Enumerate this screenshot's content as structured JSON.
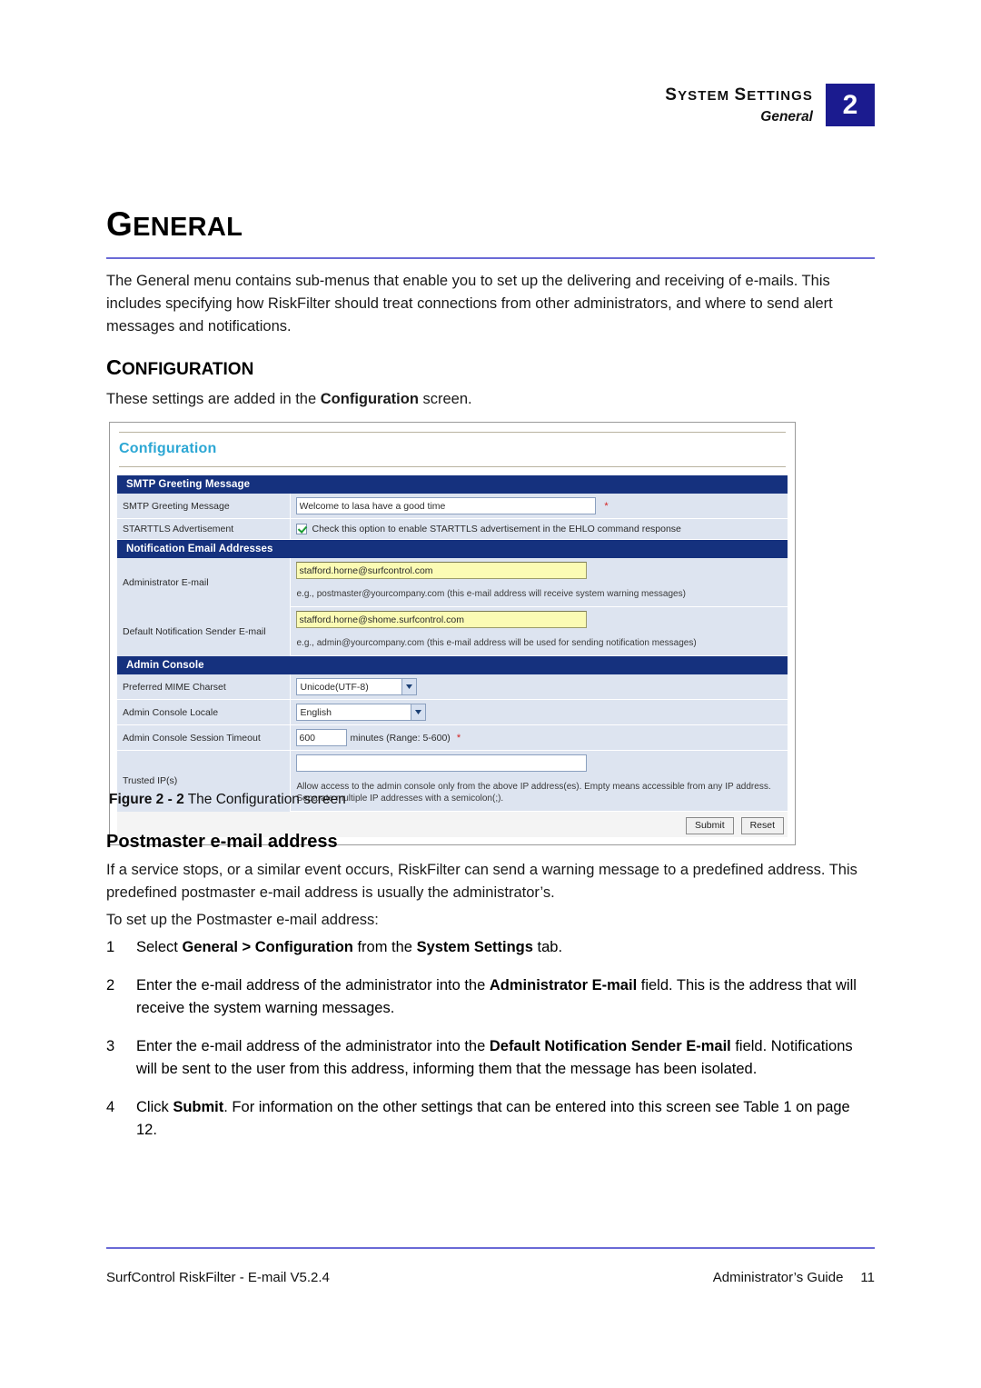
{
  "running_header": {
    "title": "SYSTEM SETTINGS",
    "subtitle": "General",
    "chapter_number": "2",
    "chapter_box_color": "#1b1b8f"
  },
  "chapter": {
    "heading": "GENERAL",
    "rule_color": "#6a6ad6",
    "intro": "The General menu contains sub-menus that enable you to set up the delivering and receiving of e-mails. This includes specifying how RiskFilter should treat connections from other administrators, and where to send alert messages and notifications."
  },
  "configuration_section": {
    "heading": "CONFIGURATION",
    "intro_before": "These settings are added in the ",
    "intro_bold": "Configuration",
    "intro_after": " screen."
  },
  "figure": {
    "title": "Configuration",
    "title_color": "#2ca7d4",
    "section_header_color": "#15317e",
    "row_background": "#dde4f0",
    "highlight_field_color": "#fbfbb4",
    "sections": [
      {
        "header": "SMTP Greeting Message",
        "rows": [
          {
            "label": "SMTP Greeting Message",
            "type": "text",
            "value": "Welcome to lasa have a good time",
            "required_marker": "*"
          },
          {
            "label": "STARTTLS Advertisement",
            "type": "checkbox",
            "checked": true,
            "checkbox_label": "Check this option to enable STARTTLS advertisement in the EHLO command response"
          }
        ]
      },
      {
        "header": "Notification Email Addresses",
        "rows": [
          {
            "label": "Administrator E-mail",
            "type": "text-highlight",
            "value": "stafford.horne@surfcontrol.com",
            "hint": "e.g., postmaster@yourcompany.com (this e-mail address will receive system warning messages)"
          },
          {
            "label": "Default Notification Sender E-mail",
            "type": "text-highlight",
            "value": "stafford.horne@shome.surfcontrol.com",
            "hint": "e.g., admin@yourcompany.com (this e-mail address will be used for sending notification messages)"
          }
        ]
      },
      {
        "header": "Admin Console",
        "rows": [
          {
            "label": "Preferred MIME Charset",
            "type": "select",
            "value": "Unicode(UTF-8)"
          },
          {
            "label": "Admin Console Locale",
            "type": "select",
            "value": "English"
          },
          {
            "label": "Admin Console Session Timeout",
            "type": "number",
            "value": "600",
            "unit": "minutes (Range: 5-600)",
            "required_marker": "*"
          },
          {
            "label": "Trusted IP(s)",
            "type": "text",
            "value": "",
            "hint": "Allow access to the admin console only from the above IP address(es). Empty means accessible from any IP address. Separate multiple IP addresses with a semicolon(;)."
          }
        ]
      }
    ],
    "buttons": {
      "submit": "Submit",
      "reset": "Reset"
    }
  },
  "figure_caption": {
    "label": "Figure 2 - 2",
    "text": "The Configuration screen"
  },
  "postmaster": {
    "heading": "Postmaster e-mail address",
    "para1": "If a service stops, or a similar event occurs, RiskFilter can send a warning message to a predefined address. This predefined postmaster e-mail address is usually the administrator’s.",
    "para2": "To set up the Postmaster e-mail address:",
    "steps": [
      {
        "number": "1",
        "parts": [
          {
            "t": "Select ",
            "b": false
          },
          {
            "t": "General > Configuration",
            "b": true
          },
          {
            "t": " from the ",
            "b": false
          },
          {
            "t": "System Settings",
            "b": true
          },
          {
            "t": " tab.",
            "b": false
          }
        ]
      },
      {
        "number": "2",
        "parts": [
          {
            "t": "Enter the e-mail address of the administrator into the ",
            "b": false
          },
          {
            "t": "Administrator E-mail",
            "b": true
          },
          {
            "t": " field. This is the address that will receive the system warning messages.",
            "b": false
          }
        ]
      },
      {
        "number": "3",
        "parts": [
          {
            "t": "Enter the e-mail address of the administrator into the ",
            "b": false
          },
          {
            "t": "Default Notification Sender E-mail",
            "b": true
          },
          {
            "t": " field. Notifications will be sent to the user from this address, informing them that the message has been isolated.",
            "b": false
          }
        ]
      },
      {
        "number": "4",
        "parts": [
          {
            "t": "Click ",
            "b": false
          },
          {
            "t": "Submit",
            "b": true
          },
          {
            "t": ". For information on the other settings that can be entered into this screen see Table 1 on page 12.",
            "b": false
          }
        ]
      }
    ]
  },
  "footer": {
    "left": "SurfControl RiskFilter - E-mail V5.2.4",
    "right": "Administrator’s Guide",
    "page_number": "11",
    "rule_color": "#6a6ad6"
  }
}
